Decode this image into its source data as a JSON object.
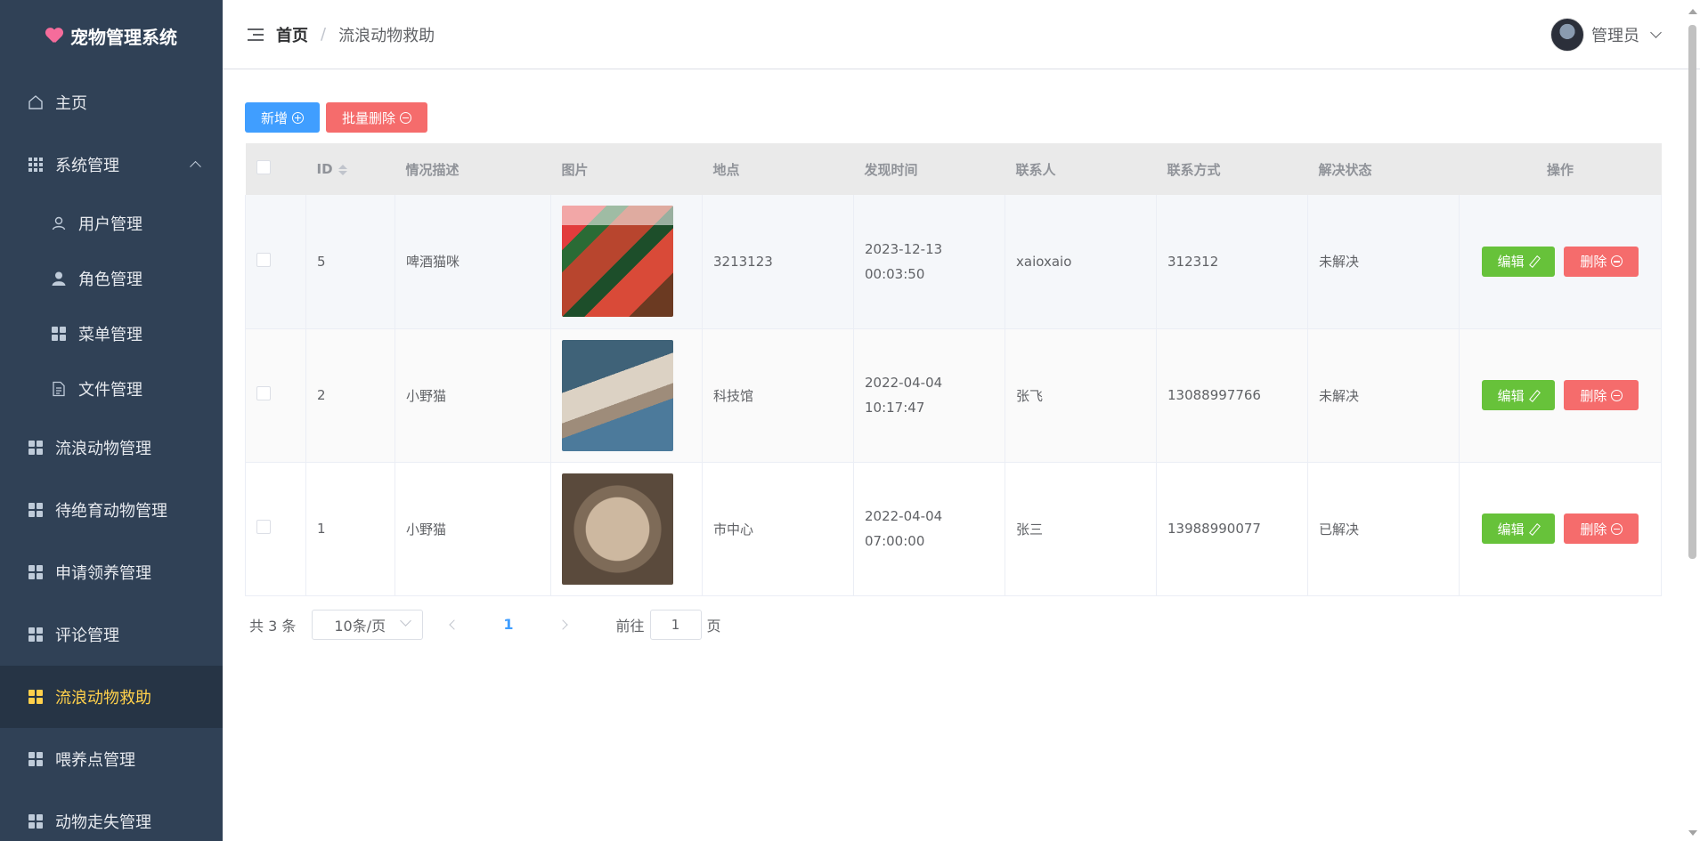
{
  "app": {
    "title": "宠物管理系统"
  },
  "sidebar": {
    "home": "主页",
    "system": "系统管理",
    "submenu": [
      "用户管理",
      "角色管理",
      "菜单管理",
      "文件管理"
    ],
    "items": [
      "流浪动物管理",
      "待绝育动物管理",
      "申请领养管理",
      "评论管理",
      "流浪动物救助",
      "喂养点管理",
      "动物走失管理"
    ],
    "active": "流浪动物救助"
  },
  "header": {
    "breadcrumb_home": "首页",
    "breadcrumb_sep": "/",
    "breadcrumb_current": "流浪动物救助",
    "user": "管理员"
  },
  "toolbar": {
    "add": "新增",
    "batch_delete": "批量删除"
  },
  "table": {
    "columns": [
      "ID",
      "情况描述",
      "图片",
      "地点",
      "发现时间",
      "联系人",
      "联系方式",
      "解决状态",
      "操作"
    ],
    "rows": [
      {
        "id": "5",
        "desc": "啤酒猫咪",
        "location": "3213123",
        "time": "2023-12-13 00:03:50",
        "contact": "xaioxaio",
        "phone": "312312",
        "status": "未解决"
      },
      {
        "id": "2",
        "desc": "小野猫",
        "location": "科技馆",
        "time": "2022-04-04 10:17:47",
        "contact": "张飞",
        "phone": "13088997766",
        "status": "未解决"
      },
      {
        "id": "1",
        "desc": "小野猫",
        "location": "市中心",
        "time": "2022-04-04 07:00:00",
        "contact": "张三",
        "phone": "13988990077",
        "status": "已解决"
      }
    ],
    "edit_label": "编辑",
    "delete_label": "删除"
  },
  "pagination": {
    "total": "共 3 条",
    "page_size": "10条/页",
    "current_page": "1",
    "goto_prefix": "前往",
    "goto_value": "1",
    "goto_suffix": "页"
  }
}
